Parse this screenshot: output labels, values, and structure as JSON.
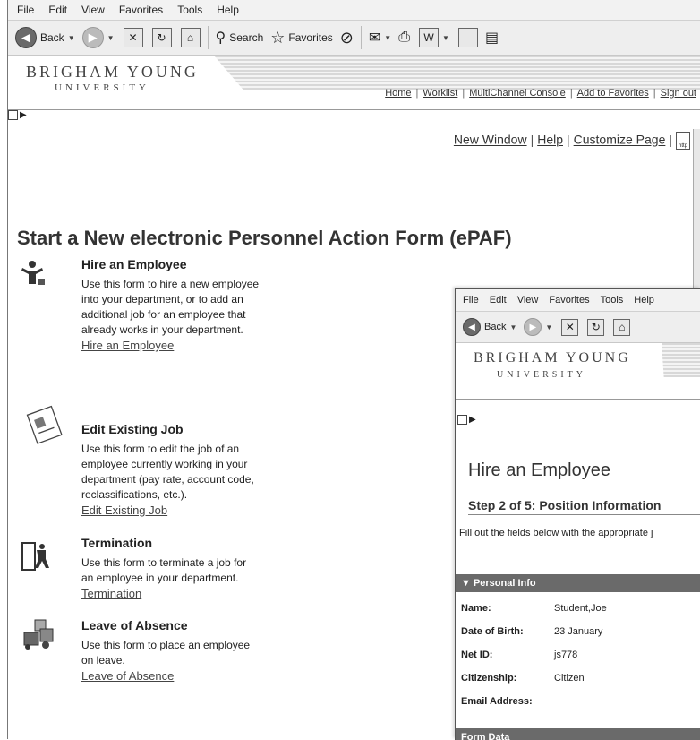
{
  "menu": [
    "File",
    "Edit",
    "View",
    "Favorites",
    "Tools",
    "Help"
  ],
  "toolbar": {
    "back": "Back",
    "search": "Search",
    "favorites": "Favorites"
  },
  "banner": {
    "line1": "BRIGHAM YOUNG",
    "line2": "UNIVERSITY"
  },
  "nav": [
    "Home",
    "Worklist",
    "MultiChannel Console",
    "Add to Favorites",
    "Sign out"
  ],
  "utility": {
    "new_window": "New Window",
    "help": "Help",
    "customize": "Customize Page",
    "http": "http"
  },
  "main": {
    "title": "Start a New electronic Personnel Action Form (ePAF)",
    "items": [
      {
        "heading": "Hire an Employee",
        "desc": "Use this form to hire a new employee into your department, or to add an additional job for an employee that already works in your department.",
        "link": "Hire an Employee"
      },
      {
        "heading": "Edit Existing Job",
        "desc": "Use this form to edit the job of an employee currently working in your department (pay rate, account code, reclassifications, etc.).",
        "link": "Edit Existing Job"
      },
      {
        "heading": "Termination",
        "desc": "Use this form to terminate a job for an employee in your department.",
        "link": "Termination"
      },
      {
        "heading": "Leave of Absence",
        "desc": "Use this form to place an employee on leave.",
        "link": "Leave of Absence"
      }
    ]
  },
  "second": {
    "menu": [
      "File",
      "Edit",
      "View",
      "Favorites",
      "Tools",
      "Help"
    ],
    "back": "Back",
    "title": "Hire an Employee",
    "step": "Step 2 of 5: Position Information",
    "instructions": "Fill out the fields below with the appropriate j",
    "personal_header": "▼ Personal Info",
    "fields": [
      {
        "label": "Name:",
        "value": "Student,Joe"
      },
      {
        "label": "Date of Birth:",
        "value": "23 January"
      },
      {
        "label": "Net ID:",
        "value": "js778"
      },
      {
        "label": "Citizenship:",
        "value": "Citizen"
      },
      {
        "label": "Email Address:",
        "value": ""
      }
    ],
    "form_header": "Form Data"
  }
}
